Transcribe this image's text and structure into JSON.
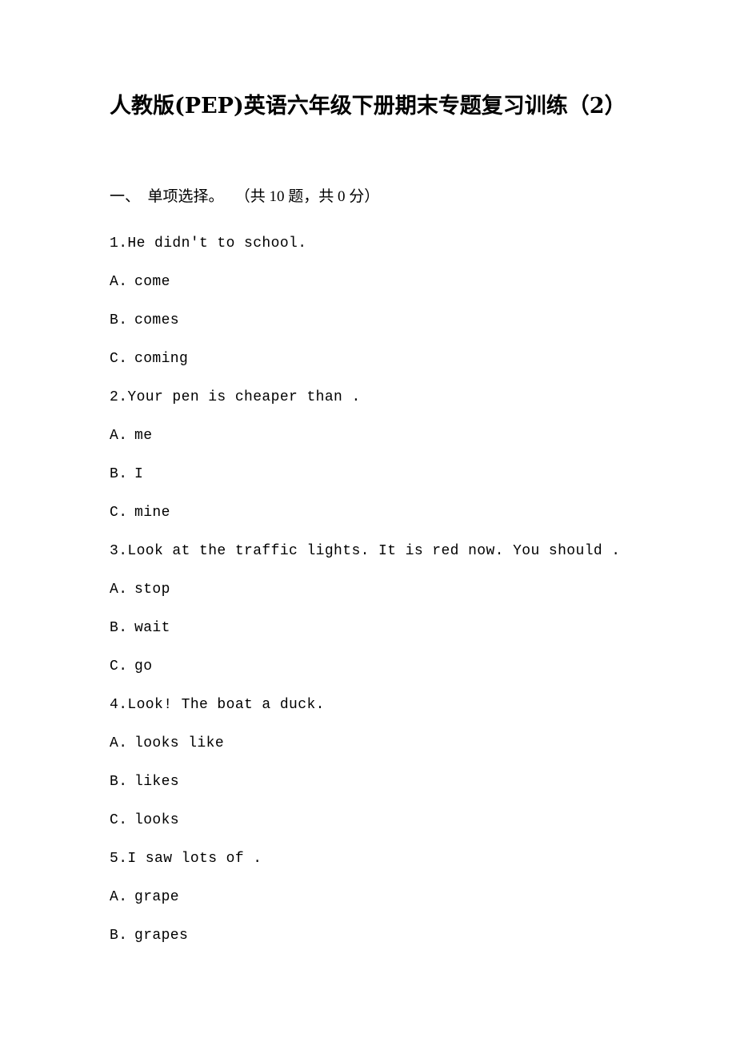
{
  "document": {
    "title": "人教版(PEP)英语六年级下册期末专题复习训练（2）",
    "sections": [
      {
        "header": "一、  单项选择。   （共 10 题，共 0 分）",
        "questions": [
          {
            "stem": "1.He didn't to school.",
            "options": [
              {
                "label": "A.",
                "text": "come"
              },
              {
                "label": "B.",
                "text": "comes"
              },
              {
                "label": "C.",
                "text": "coming"
              }
            ]
          },
          {
            "stem": "2.Your pen is cheaper than .",
            "options": [
              {
                "label": "A.",
                "text": "me"
              },
              {
                "label": "B.",
                "text": "I"
              },
              {
                "label": "C.",
                "text": "mine"
              }
            ]
          },
          {
            "stem": "3.Look at the traffic lights. It is red now. You should .",
            "options": [
              {
                "label": "A.",
                "text": "stop"
              },
              {
                "label": "B.",
                "text": "wait"
              },
              {
                "label": "C.",
                "text": "go"
              }
            ]
          },
          {
            "stem": "4.Look! The boat a duck.",
            "options": [
              {
                "label": "A.",
                "text": "looks like"
              },
              {
                "label": "B.",
                "text": "likes"
              },
              {
                "label": "C.",
                "text": "looks"
              }
            ]
          },
          {
            "stem": "5.I saw lots of .",
            "options": [
              {
                "label": "A.",
                "text": "grape"
              },
              {
                "label": "B.",
                "text": "grapes"
              }
            ]
          }
        ]
      }
    ]
  }
}
